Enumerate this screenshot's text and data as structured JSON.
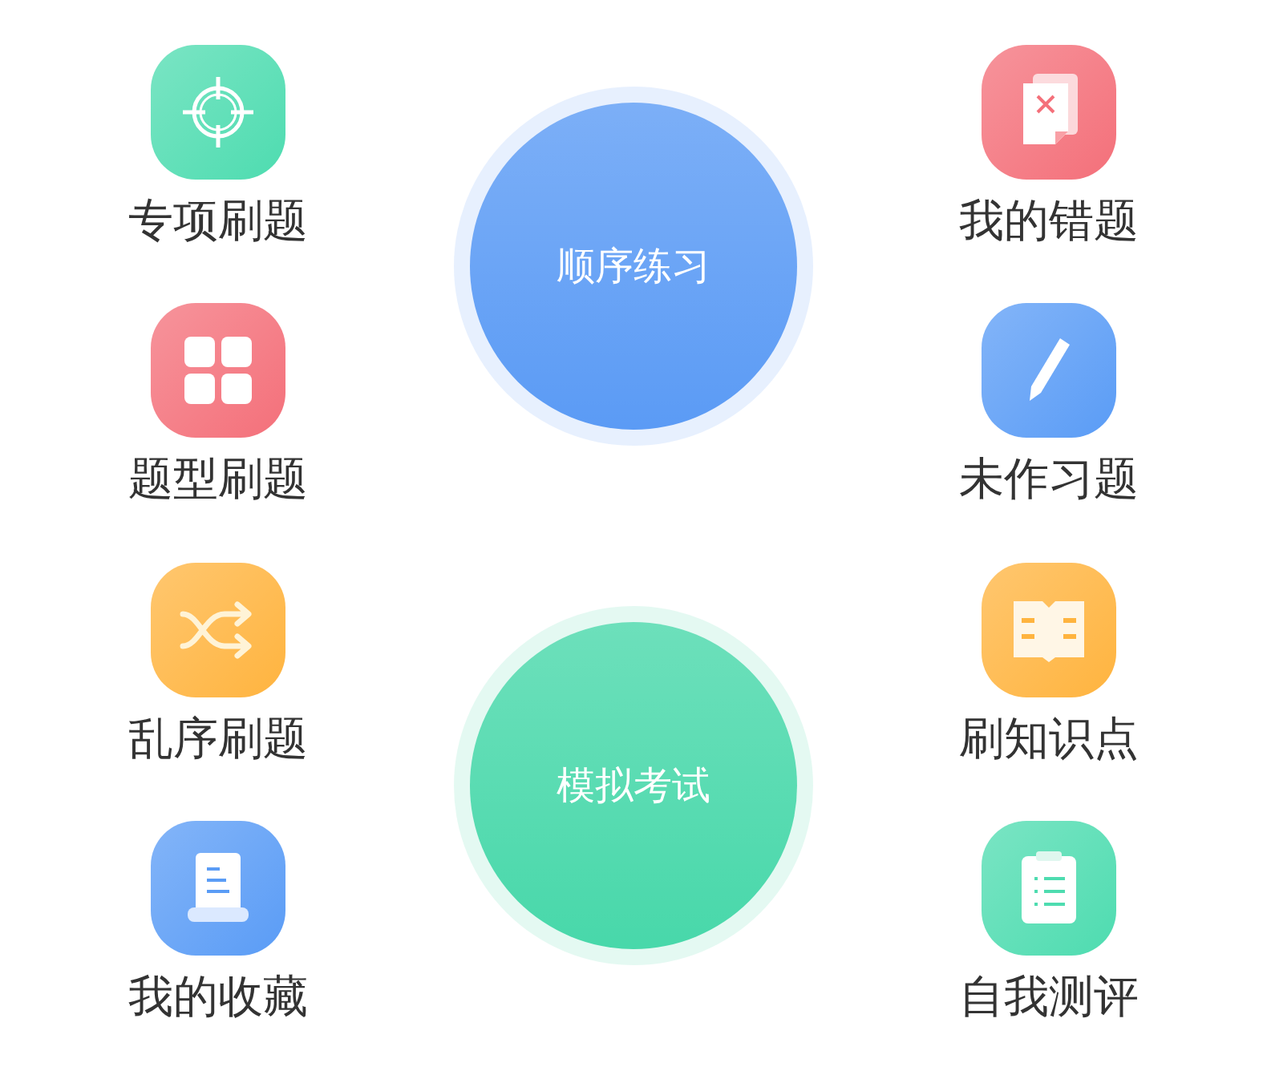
{
  "left_items": [
    {
      "label": "专项刷题",
      "kind": "target",
      "color": "#4edcb0"
    },
    {
      "label": "题型刷题",
      "kind": "grid",
      "color": "#f4707a"
    },
    {
      "label": "乱序刷题",
      "kind": "shuffle",
      "color": "#ffb43f"
    },
    {
      "label": "我的收藏",
      "kind": "scroll",
      "color": "#5a9cf6"
    }
  ],
  "center_buttons": [
    {
      "label": "顺序练习",
      "color": "#5b9bf5"
    },
    {
      "label": "模拟考试",
      "color": "#48d8aa"
    }
  ],
  "right_items": [
    {
      "label": "我的错题",
      "kind": "wrong",
      "color": "#f4707a"
    },
    {
      "label": "未作习题",
      "kind": "pencil",
      "color": "#5a9cf6"
    },
    {
      "label": "刷知识点",
      "kind": "book",
      "color": "#ffb43f"
    },
    {
      "label": "自我测评",
      "kind": "clipboard",
      "color": "#4edcb0"
    }
  ]
}
